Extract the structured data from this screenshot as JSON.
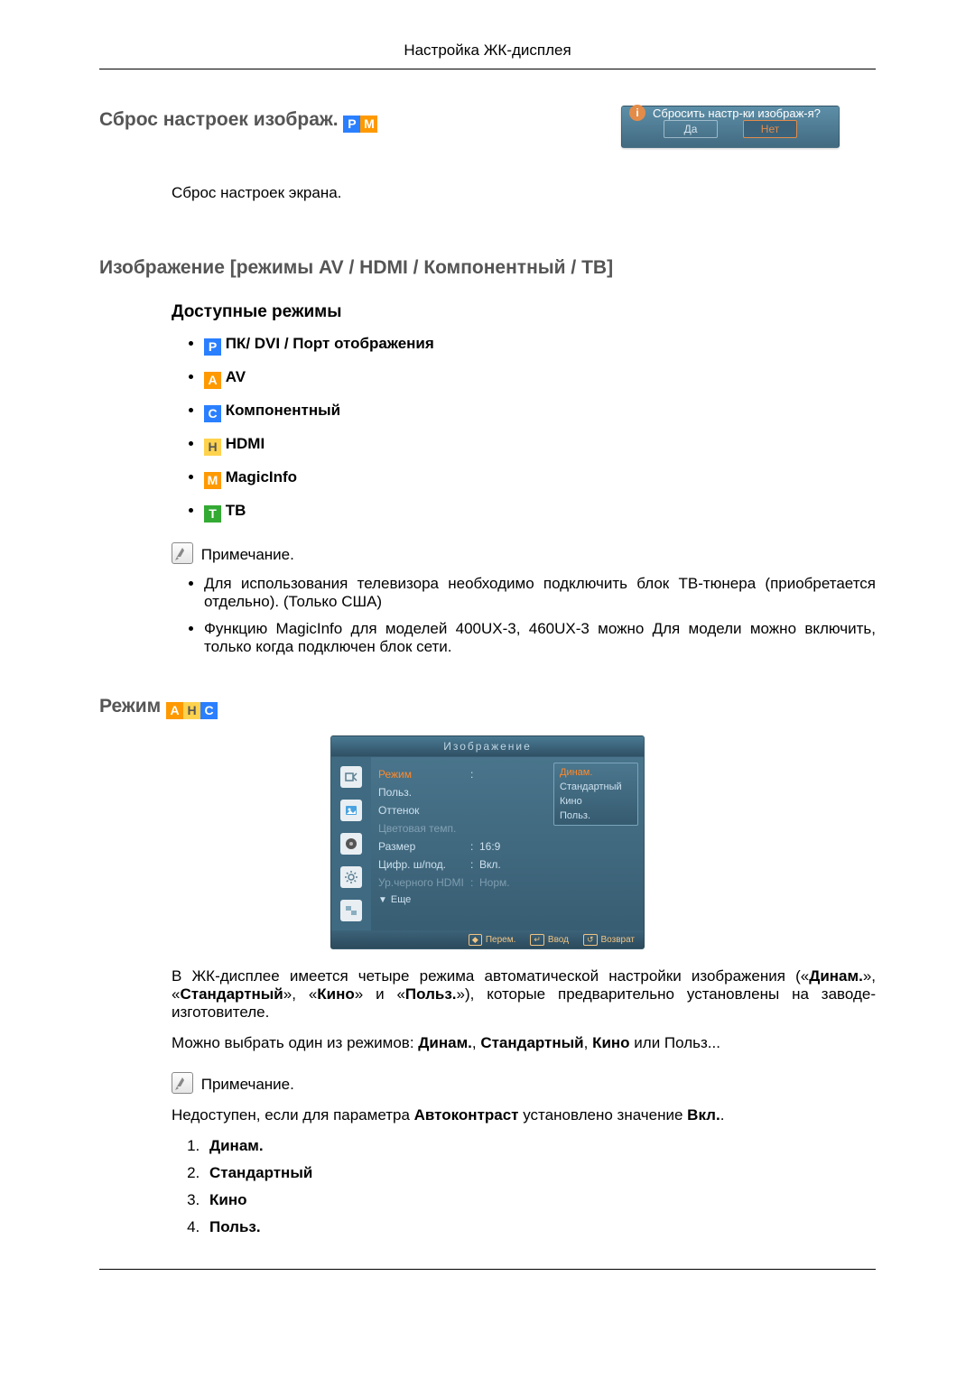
{
  "header": {
    "title": "Настройка ЖК-дисплея"
  },
  "section_reset": {
    "title": "Сброс настроек изображ.",
    "badges": [
      "P",
      "M"
    ],
    "dialog": {
      "question": "Сбросить настр-ки изображ-я?",
      "yes": "Да",
      "no": "Нет"
    },
    "desc": "Сброс настроек экрана."
  },
  "section_image": {
    "title": "Изображение [режимы AV / HDMI / Компонентный / ТВ]",
    "available_title": "Доступные режимы",
    "modes": [
      {
        "badge": "P",
        "label": "ПК/ DVI / Порт отображения"
      },
      {
        "badge": "A",
        "label": "AV"
      },
      {
        "badge": "C",
        "label": "Компонентный"
      },
      {
        "badge": "H",
        "label": "HDMI"
      },
      {
        "badge": "M",
        "label": "MagicInfo"
      },
      {
        "badge": "T",
        "label": "ТВ"
      }
    ],
    "note_label": "Примечание.",
    "note_items": [
      "Для использования телевизора необходимо подключить блок ТВ-тюнера (приобретается отдельно). (Только США)",
      "Функцию MagicInfo для моделей 400UX-3, 460UX-3 можно Для модели можно включить, только когда подключен блок сети."
    ]
  },
  "section_mode": {
    "title": "Режим",
    "badges": [
      "A",
      "H",
      "C"
    ],
    "osd": {
      "title": "Изображение",
      "rows": [
        {
          "label": "Режим",
          "value": "Динам.",
          "highlight": true
        },
        {
          "label": "Польз.",
          "value": ""
        },
        {
          "label": "Оттенок",
          "value": ""
        },
        {
          "label": "Цветовая темп.",
          "value": "",
          "dim": true
        },
        {
          "label": "Размер",
          "value": "16:9"
        },
        {
          "label": "Цифр. ш/под.",
          "value": "Вкл."
        },
        {
          "label": "Ур.черного HDMI",
          "value": "Норм.",
          "dim": true
        }
      ],
      "submenu": [
        "Динам.",
        "Стандартный",
        "Кино",
        "Польз."
      ],
      "submenu_highlight_index": 0,
      "more": "Еще",
      "footer": {
        "move": "Перем.",
        "enter": "Ввод",
        "return": "Возврат"
      }
    },
    "paragraph_pre": "В ЖК-дисплее имеется четыре режима автоматической настройки изображения («",
    "b1": "Динам.",
    "sep1": "», «",
    "b2": "Стандартный",
    "sep2": "», «",
    "b3": "Кино",
    "sep3": "» и «",
    "b4": "Польз.",
    "paragraph_post": "»), которые предварительно установлены на заводе-изготовителе.",
    "line2_pre": "Можно выбрать один из режимов: ",
    "s1": "Динам.",
    "c1": ", ",
    "s2": "Стандартный",
    "c2": ", ",
    "s3": "Кино",
    "c3_pre": " или ",
    "s4": "Польз.",
    "dot2": "..",
    "note_label": "Примечание.",
    "unavailable_pre": "Недоступен, если для параметра ",
    "auto_contrast": "Автоконтраст",
    "unavailable_mid": " установлено значение ",
    "on": "Вкл.",
    "dot3": ".",
    "list": [
      "Динам.",
      "Стандартный",
      "Кино",
      "Польз."
    ]
  }
}
